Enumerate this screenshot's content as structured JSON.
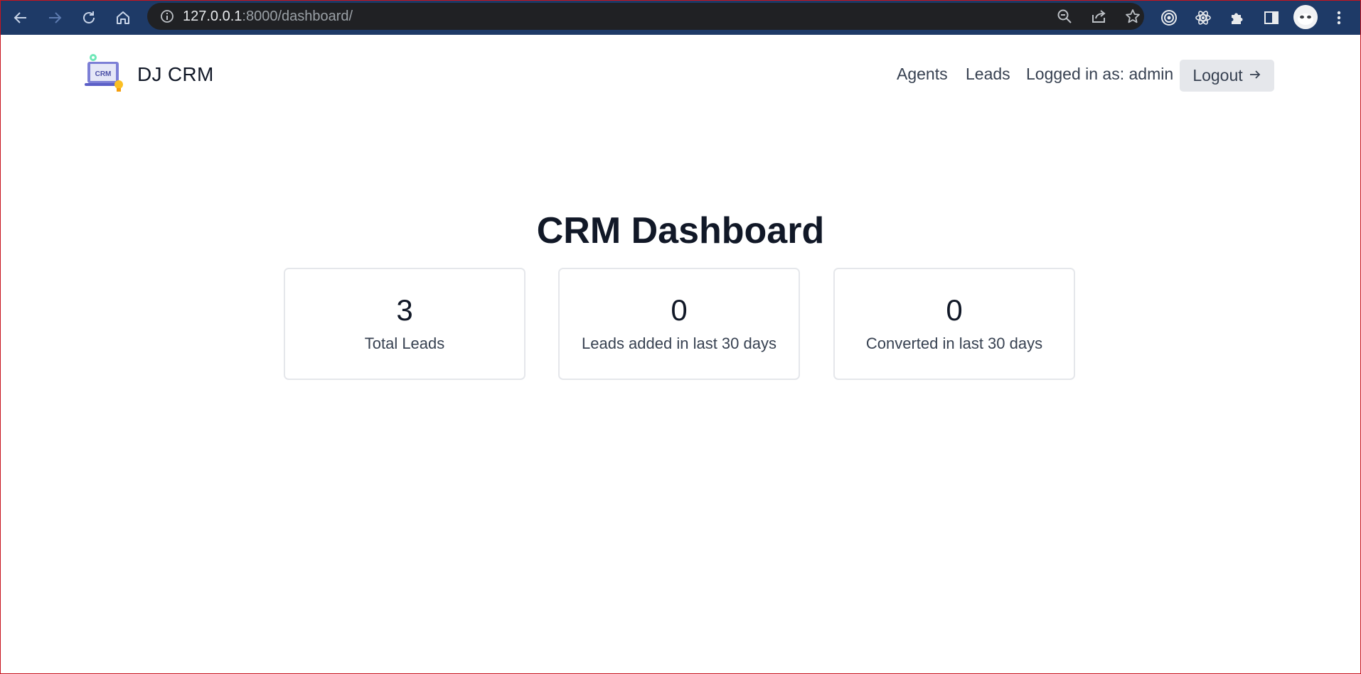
{
  "browser": {
    "url_host": "127.0.0.1",
    "url_rest": ":8000/dashboard/",
    "icons": [
      "back-icon",
      "forward-icon",
      "reload-icon",
      "home-icon",
      "info-icon",
      "zoom-icon",
      "share-icon",
      "star-icon",
      "extension-target-icon",
      "react-devtools-icon",
      "puzzle-icon",
      "sidebar-icon",
      "avatar",
      "kebab-menu-icon"
    ]
  },
  "navbar": {
    "brand": "DJ CRM",
    "logo_text": "CRM",
    "links": {
      "agents": "Agents",
      "leads": "Leads",
      "logged_in": "Logged in as: admin"
    },
    "logout": "Logout",
    "logout_icon": "arrow-right-icon"
  },
  "main": {
    "title": "CRM Dashboard",
    "cards": [
      {
        "value": "3",
        "label": "Total Leads"
      },
      {
        "value": "0",
        "label": "Leads added in last 30 days"
      },
      {
        "value": "0",
        "label": "Converted in last 30 days"
      }
    ]
  },
  "colors": {
    "toolbar": "#1e3a67",
    "omnibox": "#202124",
    "text_dark": "#111827",
    "text_body": "#374151",
    "button_bg": "#e5e7eb",
    "frame_border": "#c8141e"
  }
}
